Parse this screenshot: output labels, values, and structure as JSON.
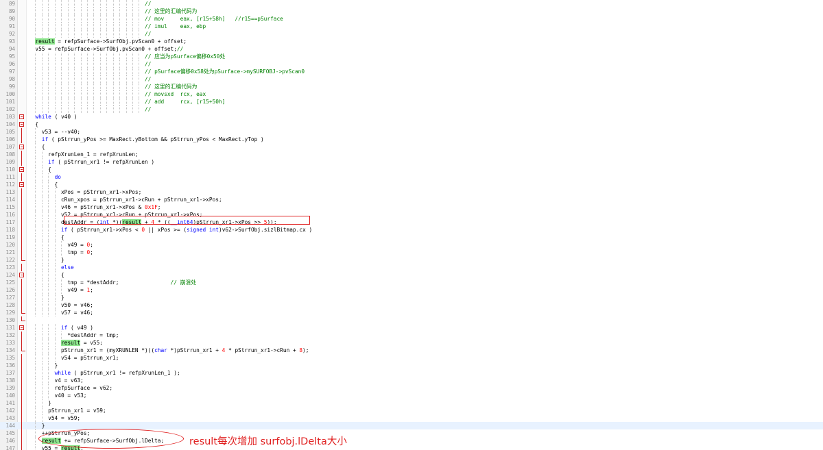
{
  "colors": {
    "keyword": "#0000ff",
    "comment": "#008000",
    "number": "#ff0000",
    "highlight": "#8ee68e",
    "annotation": "#e02020",
    "line_number": "#8a8a8a"
  },
  "annotation": {
    "note": "result每次增加 surfobj.lDelta大小"
  },
  "lines": [
    {
      "n": "89",
      "t": "                                    //"
    },
    {
      "n": "89",
      "t": "                                    // 这里的汇编代码为"
    },
    {
      "n": "90",
      "t": "                                    // mov     eax, [r15+58h]   //r15==pSurface"
    },
    {
      "n": "91",
      "t": "                                    // imul    eax, ebp"
    },
    {
      "n": "92",
      "t": "                                    //"
    },
    {
      "n": "93",
      "t": "  result = refpSurface->SurfObj.pvScan0 + offset;"
    },
    {
      "n": "94",
      "t": "  v55 = refpSurface->SurfObj.pvScan0 + offset;//"
    },
    {
      "n": "95",
      "t": "                                    // 应当为pSurface偏移0x50处"
    },
    {
      "n": "96",
      "t": "                                    //"
    },
    {
      "n": "97",
      "t": "                                    // pSurface偏移0x58处为pSurface->mySURFOBJ->pvScan0"
    },
    {
      "n": "98",
      "t": "                                    //"
    },
    {
      "n": "99",
      "t": "                                    // 这里的汇编代码为"
    },
    {
      "n": "100",
      "t": "                                    // movsxd  rcx, eax"
    },
    {
      "n": "101",
      "t": "                                    // add     rcx, [r15+50h]"
    },
    {
      "n": "102",
      "t": "                                    //"
    },
    {
      "n": "103",
      "t": "  while ( v40 )"
    },
    {
      "n": "104",
      "t": "  {"
    },
    {
      "n": "105",
      "t": "    v53 = --v40;"
    },
    {
      "n": "106",
      "t": "    if ( pStrrun_yPos >= MaxRect.yBottom && pStrrun_yPos < MaxRect.yTop )"
    },
    {
      "n": "107",
      "t": "    {"
    },
    {
      "n": "108",
      "t": "      refpXrunLen_1 = refpXrunLen;"
    },
    {
      "n": "109",
      "t": "      if ( pStrrun_xr1 != refpXrunLen )"
    },
    {
      "n": "110",
      "t": "      {"
    },
    {
      "n": "111",
      "t": "        do"
    },
    {
      "n": "112",
      "t": "        {"
    },
    {
      "n": "113",
      "t": "          xPos = pStrrun_xr1->xPos;"
    },
    {
      "n": "114",
      "t": "          cRun_xpos = pStrrun_xr1->cRun + pStrrun_xr1->xPos;"
    },
    {
      "n": "115",
      "t": "          v46 = pStrrun_xr1->xPos & 0x1F;"
    },
    {
      "n": "116",
      "t": "          v52 = pStrrun_xr1->cRun + pStrrun_xr1->xPos;"
    },
    {
      "n": "117",
      "t": "          destAddr = (int *)(result + 4 * ((__int64)pStrrun_xr1->xPos >> 5));"
    },
    {
      "n": "118",
      "t": "          if ( pStrrun_xr1->xPos < 0 || xPos >= (signed int)v62->SurfObj.sizlBitmap.cx )"
    },
    {
      "n": "119",
      "t": "          {"
    },
    {
      "n": "120",
      "t": "            v49 = 0;"
    },
    {
      "n": "121",
      "t": "            tmp = 0;"
    },
    {
      "n": "122",
      "t": "          }"
    },
    {
      "n": "123",
      "t": "          else"
    },
    {
      "n": "124",
      "t": "          {"
    },
    {
      "n": "125",
      "t": "            tmp = *destAddr;                // 崩溃处"
    },
    {
      "n": "126",
      "t": "            v49 = 1;"
    },
    {
      "n": "127",
      "t": "          }"
    },
    {
      "n": "128",
      "t": "          v50 = v46;"
    },
    {
      "n": "129",
      "t": "          v57 = v46;"
    },
    {
      "n": "130",
      "t": ""
    },
    {
      "n": "131",
      "t": "          if ( v49 )"
    },
    {
      "n": "132",
      "t": "            *destAddr = tmp;"
    },
    {
      "n": "133",
      "t": "          result = v55;"
    },
    {
      "n": "134",
      "t": "          pStrrun_xr1 = (myXRUNLEN *)((char *)pStrrun_xr1 + 4 * pStrrun_xr1->cRun + 8);"
    },
    {
      "n": "135",
      "t": "          v54 = pStrrun_xr1;"
    },
    {
      "n": "136",
      "t": "        }"
    },
    {
      "n": "137",
      "t": "        while ( pStrrun_xr1 != refpXrunLen_1 );"
    },
    {
      "n": "138",
      "t": "        v4 = v63;"
    },
    {
      "n": "139",
      "t": "        refpSurface = v62;"
    },
    {
      "n": "140",
      "t": "        v40 = v53;"
    },
    {
      "n": "141",
      "t": "      }"
    },
    {
      "n": "142",
      "t": "      pStrrun_xr1 = v59;"
    },
    {
      "n": "143",
      "t": "      v54 = v59;"
    },
    {
      "n": "144",
      "t": "    }"
    },
    {
      "n": "145",
      "t": "    ++pStrrun_yPos;"
    },
    {
      "n": "146",
      "t": "    result += refpSurface->SurfObj.lDelta;"
    },
    {
      "n": "147",
      "t": "    v55 = result;"
    }
  ]
}
